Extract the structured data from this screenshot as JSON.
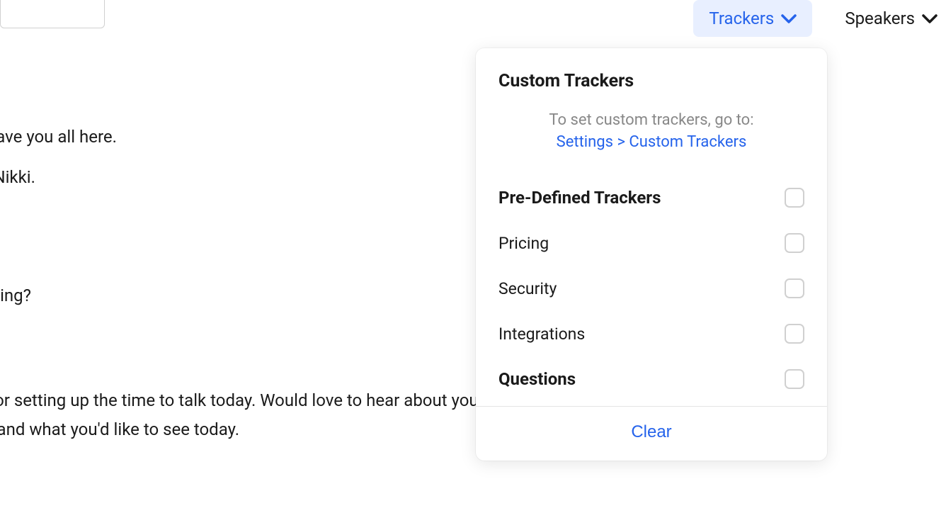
{
  "filters": {
    "trackers": {
      "label": "Trackers",
      "active": true
    },
    "speakers": {
      "label": "Speakers",
      "active": false
    }
  },
  "transcript": {
    "line1": "t to have you all here.",
    "line2": "Hey, Nikki.",
    "line3": "ou doing?",
    "line4a": "nks for setting up the time to talk today. Would love to hear about your company",
    "line4b": "g for and what you'd like to see today."
  },
  "trackers_panel": {
    "custom_title": "Custom Trackers",
    "custom_hint": "To set custom trackers, go to:",
    "custom_link": "Settings > Custom Trackers",
    "predefined_title": "Pre-Defined Trackers",
    "items": {
      "pricing": "Pricing",
      "security": "Security",
      "integrations": "Integrations",
      "questions": "Questions"
    },
    "clear_label": "Clear"
  }
}
